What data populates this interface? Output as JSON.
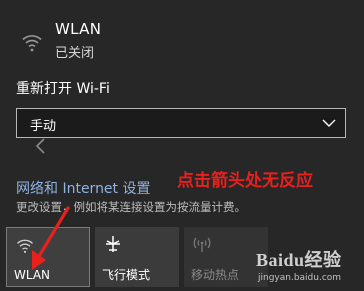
{
  "wifi": {
    "title": "WLAN",
    "status": "已关闭"
  },
  "reopen_label": "重新打开 Wi-Fi",
  "reopen_select": {
    "value": "手动"
  },
  "network_settings": {
    "link": "网络和 Internet 设置",
    "description": "更改设置，例如将某连接设置为按流量计费。"
  },
  "annotation": "点击箭头处无反应",
  "quick_actions": [
    {
      "label": "WLAN",
      "icon": "wifi-icon",
      "state": "selected"
    },
    {
      "label": "飞行模式",
      "icon": "airplane-icon",
      "state": "off"
    },
    {
      "label": "移动热点",
      "icon": "hotspot-icon",
      "state": "disabled"
    }
  ],
  "watermark": {
    "logo": "Baidu经验",
    "url": "jingyan.baidu.com"
  },
  "colors": {
    "background": "#272727",
    "link": "#8fb3e0",
    "annotation": "#e8201e"
  }
}
